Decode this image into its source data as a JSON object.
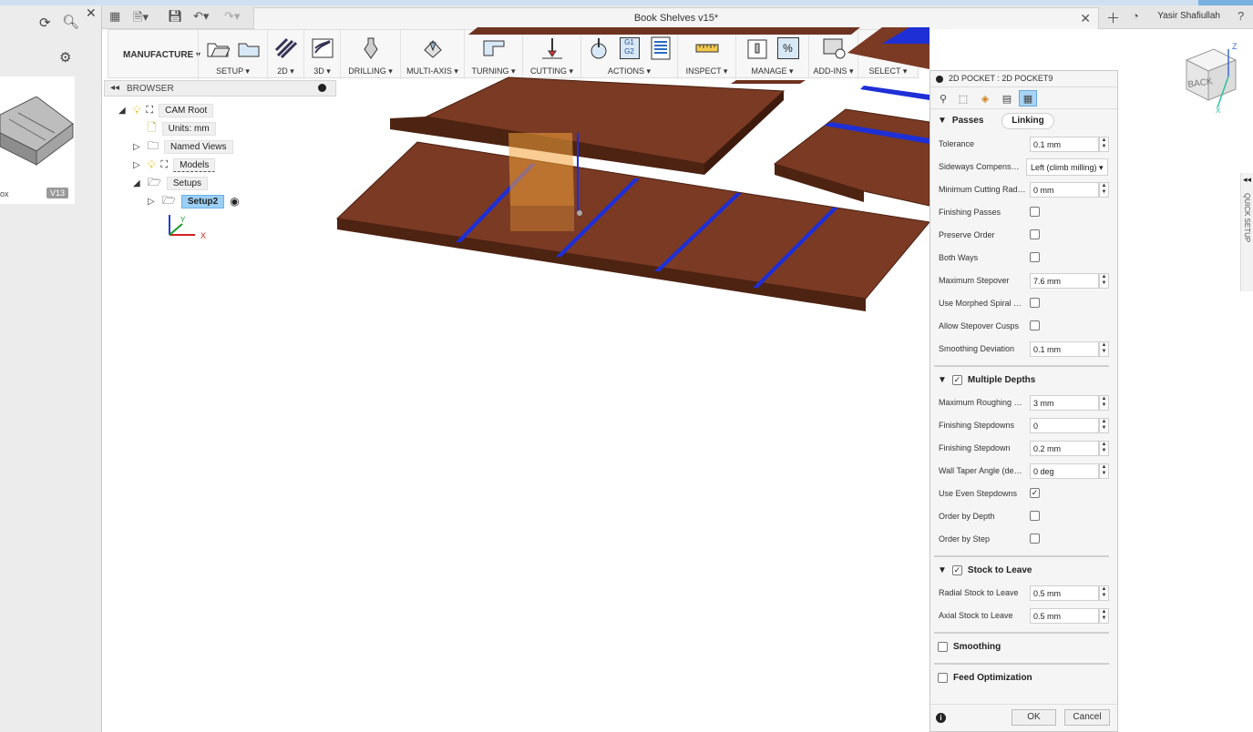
{
  "window": {
    "title": "Book Shelves v15*",
    "user": "Yasir Shafiullah"
  },
  "left_panel": {
    "thumb_name": "ox",
    "thumb_version": "V13"
  },
  "toolbar": {
    "workspace": "MANUFACTURE",
    "groups": [
      {
        "label": "SETUP"
      },
      {
        "label": "2D"
      },
      {
        "label": "3D"
      },
      {
        "label": "DRILLING"
      },
      {
        "label": "MULTI-AXIS"
      },
      {
        "label": "TURNING"
      },
      {
        "label": "CUTTING"
      },
      {
        "label": "ACTIONS"
      },
      {
        "label": "INSPECT"
      },
      {
        "label": "MANAGE"
      },
      {
        "label": "ADD-INS"
      },
      {
        "label": "SELECT"
      }
    ],
    "actions_g_code": "G1\nG2",
    "manage_percent": "%"
  },
  "browser": {
    "title": "BROWSER",
    "nodes": {
      "cam_root": "CAM Root",
      "units": "Units: mm",
      "named_views": "Named Views",
      "models": "Models",
      "setups": "Setups",
      "setup2": "Setup2"
    },
    "axis": {
      "x": "X",
      "y": "Y"
    }
  },
  "viewcube": {
    "face": "BACK",
    "z": "Z",
    "x": "X"
  },
  "quick_setup": "QUICK SETUP",
  "dialog": {
    "title": "2D POCKET : 2D POCKET9",
    "sections": {
      "passes": "Passes",
      "linking": "Linking",
      "multiple_depths": "Multiple Depths",
      "stock_to_leave": "Stock to Leave",
      "smoothing": "Smoothing",
      "feed_optimization": "Feed Optimization"
    },
    "passes": {
      "tolerance": {
        "label": "Tolerance",
        "value": "0.1 mm"
      },
      "sideways": {
        "label": "Sideways Compensation",
        "value": "Left (climb milling)"
      },
      "min_radius": {
        "label": "Minimum Cutting Radius",
        "value": "0 mm"
      },
      "finishing_passes": {
        "label": "Finishing Passes"
      },
      "preserve_order": {
        "label": "Preserve Order"
      },
      "both_ways": {
        "label": "Both Ways"
      },
      "max_stepover": {
        "label": "Maximum Stepover",
        "value": "7.6 mm"
      },
      "morphed_spiral": {
        "label": "Use Morphed Spiral Machining"
      },
      "allow_cusps": {
        "label": "Allow Stepover Cusps"
      },
      "smoothing_dev": {
        "label": "Smoothing Deviation",
        "value": "0.1 mm"
      }
    },
    "depths": {
      "max_roughing": {
        "label": "Maximum Roughing Stepdown",
        "value": "3 mm"
      },
      "fin_stepdowns": {
        "label": "Finishing Stepdowns",
        "value": "0"
      },
      "fin_stepdown": {
        "label": "Finishing Stepdown",
        "value": "0.2 mm"
      },
      "wall_taper": {
        "label": "Wall Taper Angle (degrees)",
        "value": "0 deg"
      },
      "even_stepdowns": {
        "label": "Use Even Stepdowns"
      },
      "order_depth": {
        "label": "Order by Depth"
      },
      "order_step": {
        "label": "Order by Step"
      }
    },
    "stock": {
      "radial": {
        "label": "Radial Stock to Leave",
        "value": "0.5 mm"
      },
      "axial": {
        "label": "Axial Stock to Leave",
        "value": "0.5 mm"
      }
    },
    "ok": "OK",
    "cancel": "Cancel"
  },
  "colors": {
    "wood": "#6e3320",
    "slot": "#1e2fd6",
    "selection": "#9ccff5",
    "tool_orange": "#f2a23a"
  }
}
